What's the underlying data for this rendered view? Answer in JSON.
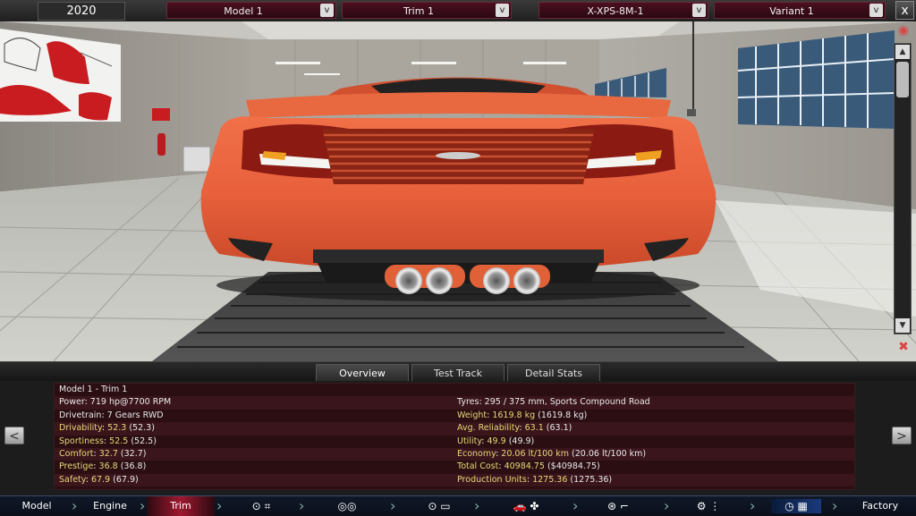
{
  "header": {
    "year": "2020",
    "model": "Model 1",
    "trim": "Trim 1",
    "engine": "X-XPS-8M-1",
    "variant": "Variant 1",
    "dropdown_glyph": "v",
    "close_glyph": "x"
  },
  "scene": {
    "poster_label": "",
    "sign_label": ""
  },
  "tabs": [
    {
      "label": "Overview"
    },
    {
      "label": "Test Track"
    },
    {
      "label": "Detail Stats"
    }
  ],
  "stats": {
    "title": "Model 1 - Trim 1",
    "left": [
      {
        "key": "Power",
        "value": "719 hp@7700 RPM",
        "paren": ""
      },
      {
        "key": "Drivetrain",
        "value": "7 Gears RWD",
        "paren": ""
      },
      {
        "key": "Drivability",
        "value": "52.3",
        "paren": "(52.3)"
      },
      {
        "key": "Sportiness",
        "value": "52.5",
        "paren": "(52.5)"
      },
      {
        "key": "Comfort",
        "value": "32.7",
        "paren": "(32.7)"
      },
      {
        "key": "Prestige",
        "value": "36.8",
        "paren": "(36.8)"
      },
      {
        "key": "Safety",
        "value": "67.9",
        "paren": "(67.9)"
      }
    ],
    "right": [
      {
        "key": "Tyres",
        "value": "295 / 375 mm, Sports Compound Road",
        "paren": ""
      },
      {
        "key": "Weight",
        "value": "1619.8 kg",
        "paren": "(1619.8 kg)"
      },
      {
        "key": "Avg. Reliability",
        "value": "63.1",
        "paren": "(63.1)"
      },
      {
        "key": "Utility",
        "value": "49.9",
        "paren": "(49.9)"
      },
      {
        "key": "Economy",
        "value": "20.06 lt/100 km",
        "paren": "(20.06 lt/100 km)"
      },
      {
        "key": "Total Cost",
        "value": "40984.75",
        "paren": "($40984.75)"
      },
      {
        "key": "Production Units",
        "value": "1275.36",
        "paren": "(1275.36)"
      }
    ],
    "prev_glyph": "<",
    "next_glyph": ">"
  },
  "bottom_nav": {
    "model": "Model",
    "engine": "Engine",
    "trim": "Trim",
    "factory": "Factory"
  },
  "colors": {
    "car_body": "#e8603c",
    "accent_red": "#a01830",
    "stat_yellow": "#e8d878"
  }
}
